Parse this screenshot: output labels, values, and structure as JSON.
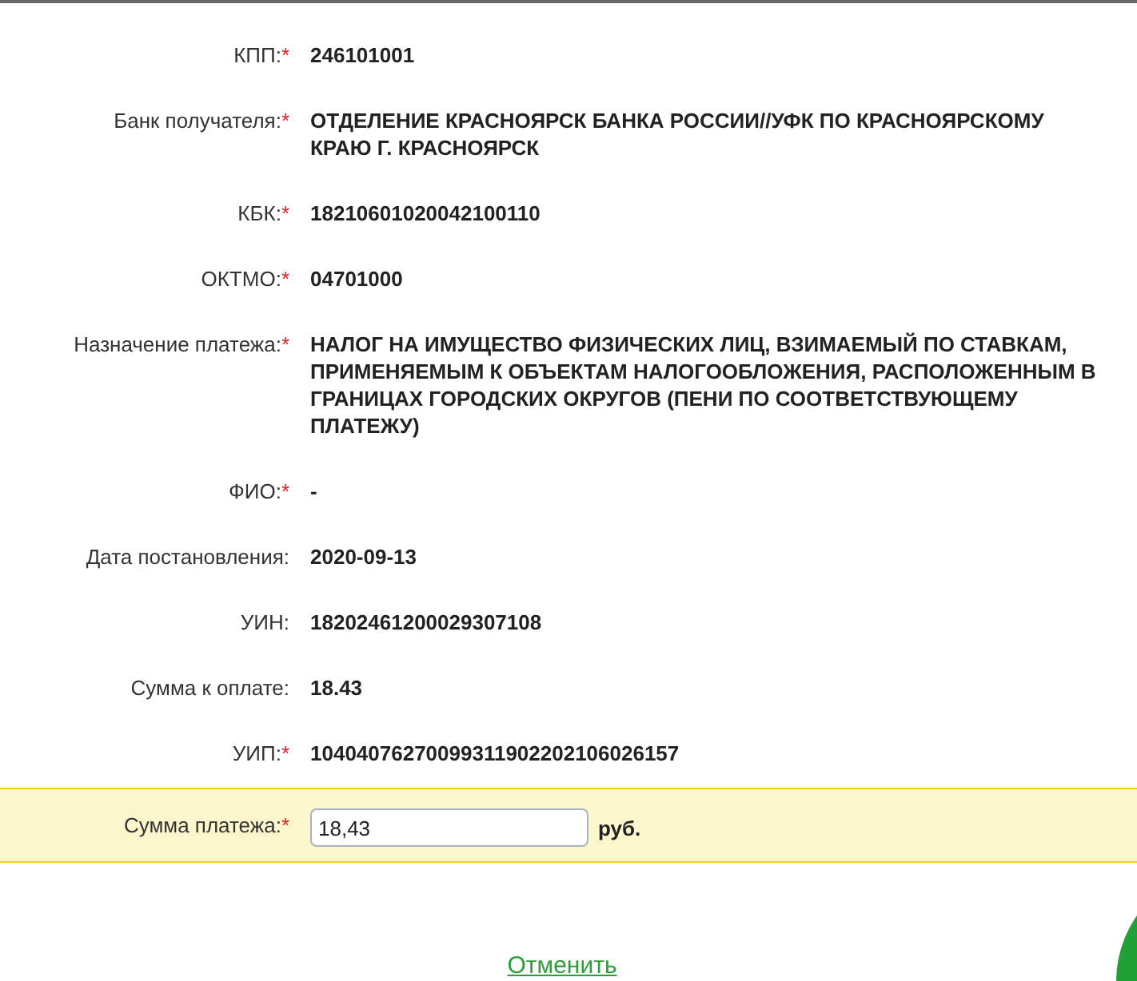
{
  "required_mark": "*",
  "fields": [
    {
      "kind": "text",
      "label": "КПП:",
      "required": true,
      "value": "246101001"
    },
    {
      "kind": "text",
      "label": "Банк получателя:",
      "required": true,
      "value": "ОТДЕЛЕНИЕ КРАСНОЯРСК БАНКА РОССИИ//УФК ПО КРАСНОЯРСКОМУ КРАЮ Г. КРАСНОЯРСК"
    },
    {
      "kind": "text",
      "label": "КБК:",
      "required": true,
      "value": "18210601020042100110"
    },
    {
      "kind": "text",
      "label": "ОКТМО:",
      "required": true,
      "value": "04701000"
    },
    {
      "kind": "text",
      "label": "Назначение платежа:",
      "required": true,
      "value": "НАЛОГ НА ИМУЩЕСТВО ФИЗИЧЕСКИХ ЛИЦ, ВЗИМАЕМЫЙ ПО СТАВКАМ, ПРИМЕНЯЕМЫМ К ОБЪЕКТАМ НАЛОГООБЛОЖЕНИЯ, РАСПОЛОЖЕННЫМ В ГРАНИЦАХ ГОРОДСКИХ ОКРУГОВ (ПЕНИ ПО СООТВЕТСТВУЮЩЕМУ ПЛАТЕЖУ)"
    },
    {
      "kind": "text",
      "label": "ФИО:",
      "required": true,
      "value": "-"
    },
    {
      "kind": "text",
      "label": "Дата постановления:",
      "required": false,
      "value": "2020-09-13"
    },
    {
      "kind": "text",
      "label": "УИН:",
      "required": false,
      "value": "18202461200029307108"
    },
    {
      "kind": "text",
      "label": "Сумма к оплате:",
      "required": false,
      "value": "18.43"
    },
    {
      "kind": "text",
      "label": "УИП:",
      "required": true,
      "value": "10404076270099311902202106026157"
    },
    {
      "kind": "input",
      "label": "Сумма платежа:",
      "required": true,
      "value": "18,43",
      "unit": "руб."
    }
  ],
  "cancel_link": "Отменить"
}
